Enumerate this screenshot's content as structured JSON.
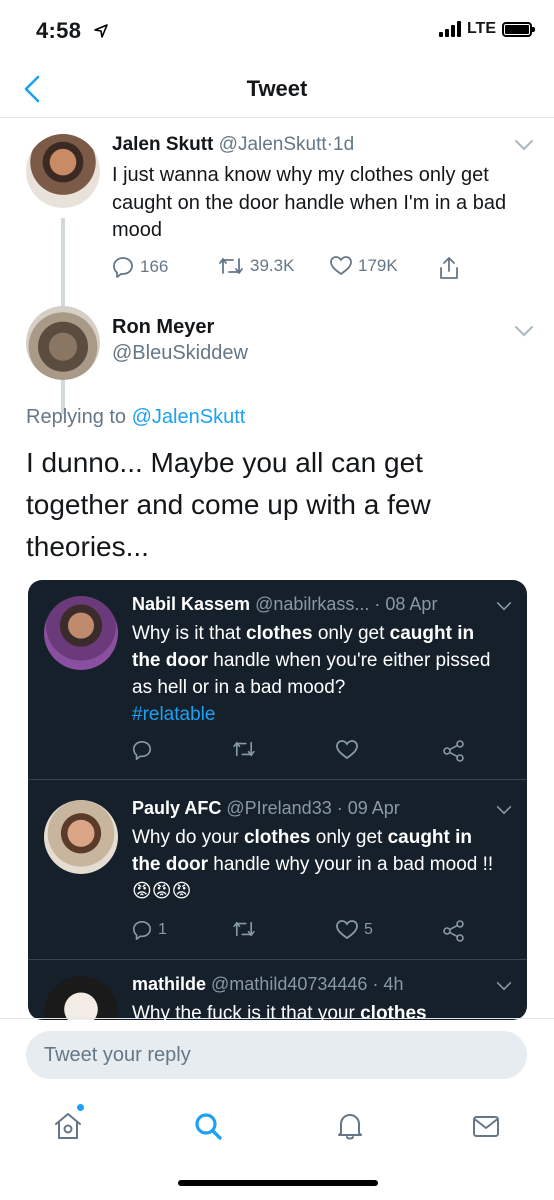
{
  "status_bar": {
    "time": "4:58",
    "network": "LTE"
  },
  "nav": {
    "title": "Tweet"
  },
  "parent_tweet": {
    "name": "Jalen Skutt",
    "handle": "@JalenSkutt",
    "separator": "·",
    "time": "1d",
    "text": "I just wanna know why my clothes only get caught on the door handle when I'm in a bad mood",
    "replies": "166",
    "retweets": "39.3K",
    "likes": "179K"
  },
  "reply_tweet": {
    "name": "Ron Meyer",
    "handle": "@BleuSkiddew",
    "replying_prefix": "Replying to",
    "replying_to": "@JalenSkutt",
    "text": "I dunno... Maybe you all can get together and come up with a few theories..."
  },
  "embedded_tweets": [
    {
      "name": "Nabil Kassem",
      "handle": "@nabilrkass...",
      "time": "· 08 Apr",
      "text_parts": [
        "Why is it that ",
        "clothes",
        " only get ",
        "caught in the door",
        " handle when you're either pissed as hell or in a bad mood?"
      ],
      "hashtag": "#relatable",
      "replies": "",
      "retweets": "",
      "likes": ""
    },
    {
      "name": "Pauly AFC",
      "handle": "@PIreland33",
      "time": "· 09 Apr",
      "text_parts": [
        "Why do your ",
        "clothes",
        " only get ",
        "caught in the door",
        " handle why your in a bad mood !! "
      ],
      "emoji": "😡😡😡",
      "replies": "1",
      "retweets": "",
      "likes": "5"
    },
    {
      "name": "mathilde",
      "handle": "@mathild40734446",
      "time": "· 4h",
      "text_parts": [
        "Why the fuck is it that your ",
        "clothes"
      ]
    }
  ],
  "reply_bar": {
    "placeholder": "Tweet your reply"
  },
  "colors": {
    "accent": "#1da1f2",
    "dark_card": "#15202b",
    "muted": "#657786"
  }
}
